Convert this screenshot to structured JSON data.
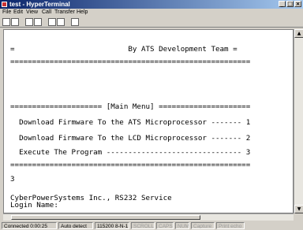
{
  "window": {
    "title": "test - HyperTerminal"
  },
  "menu": [
    "File",
    "Edit",
    "View",
    "Call",
    "Transfer",
    "Help"
  ],
  "terminal": {
    "lines": [
      "=                          By ATS Development Team =",
      "=======================================================",
      "",
      "",
      "",
      "===================== [Main Menu] =====================",
      "",
      "  Download Firmware To the ATS Microprocessor ------- 1",
      "",
      "  Download Firmware To the LCD Microprocessor ------- 2",
      "",
      "  Execute The Program ------------------------------- 3",
      "",
      "=======================================================",
      "",
      "3",
      "",
      "CyberPowerSystems Inc., RS232 Service",
      "Login Name:"
    ]
  },
  "status": {
    "connected": "Connected 0:00:25",
    "detect": "Auto detect",
    "params": "115200 8-N-1",
    "scroll": "SCROLL",
    "caps": "CAPS",
    "num": "NUM",
    "capture": "Capture",
    "echo": "Print echo"
  }
}
